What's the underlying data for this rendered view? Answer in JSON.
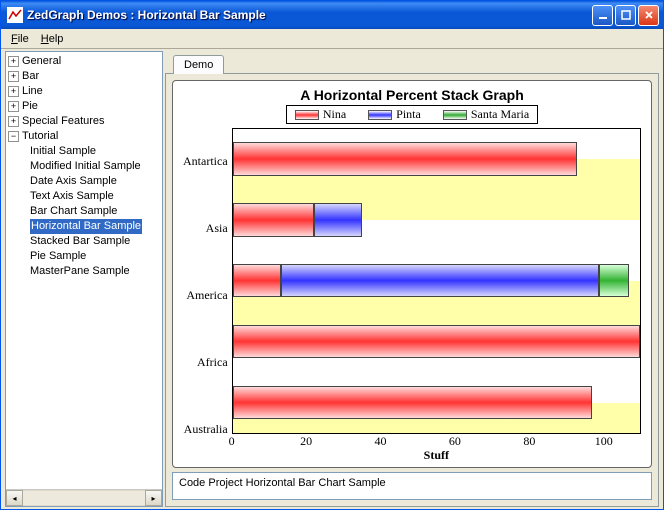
{
  "window": {
    "title": "ZedGraph Demos : Horizontal Bar Sample"
  },
  "menu": {
    "file": "File",
    "help": "Help"
  },
  "tree": {
    "top": [
      {
        "label": "General",
        "expand": "+"
      },
      {
        "label": "Bar",
        "expand": "+"
      },
      {
        "label": "Line",
        "expand": "+"
      },
      {
        "label": "Pie",
        "expand": "+"
      },
      {
        "label": "Special Features",
        "expand": "+"
      },
      {
        "label": "Tutorial",
        "expand": "−"
      }
    ],
    "tutorial_children": [
      "Initial Sample",
      "Modified Initial Sample",
      "Date Axis Sample",
      "Text Axis Sample",
      "Bar Chart Sample",
      "Horizontal Bar Sample",
      "Stacked Bar Sample",
      "Pie Sample",
      "MasterPane Sample"
    ],
    "selected_index": 5
  },
  "tab": {
    "label": "Demo"
  },
  "status": {
    "text": "Code Project Horizontal Bar Chart Sample"
  },
  "chart_data": {
    "type": "bar",
    "orientation": "horizontal",
    "stacked": true,
    "title": "A Horizontal Percent Stack Graph",
    "xlabel": "Stuff",
    "ylabel": "",
    "xlim": [
      0,
      110
    ],
    "xticks": [
      0,
      20,
      40,
      60,
      80,
      100
    ],
    "categories": [
      "Antartica",
      "Asia",
      "America",
      "Africa",
      "Australia"
    ],
    "series": [
      {
        "name": "Nina",
        "color": "#ff3333",
        "values": [
          93,
          22,
          13,
          110,
          97
        ]
      },
      {
        "name": "Pinta",
        "color": "#3333ff",
        "values": [
          0,
          13,
          86,
          0,
          0
        ]
      },
      {
        "name": "Santa Maria",
        "color": "#33aa33",
        "values": [
          0,
          0,
          8,
          0,
          0
        ]
      }
    ],
    "legend_position": "top"
  }
}
